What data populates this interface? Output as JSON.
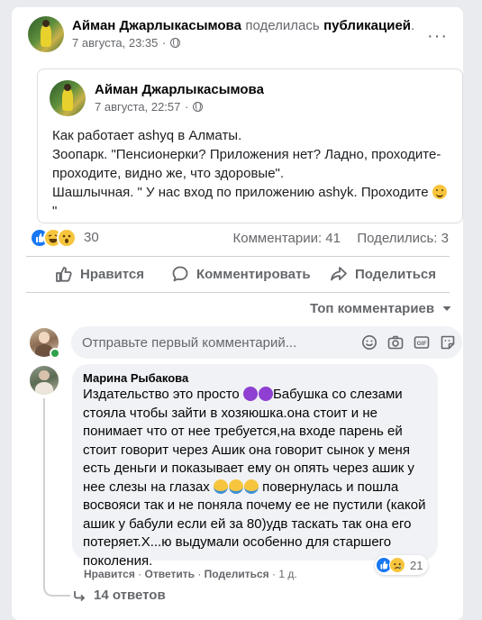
{
  "post": {
    "author": "Айман Джарлыкасымова",
    "action_pre": "поделилась",
    "action_link": "публикацией",
    "action_end": ".",
    "time": "7 августа, 23:35",
    "more": "···"
  },
  "shared": {
    "author": "Айман Джарлыкасымова",
    "time": "7 августа, 22:57",
    "text": "Как работает ashyq в Алматы.\nЗоопарк. \"Пенсионерки? Приложения нет? Ладно, проходите-\nпроходите, видно же, что здоровые\".\nШашлычная. \" У нас вход по приложению ashyk. Проходите ",
    "text_end": "\n\""
  },
  "stats": {
    "reactions_count": "30",
    "comments": "Комментарии: 41",
    "shares": "Поделились: 3"
  },
  "actions": {
    "like": "Нравится",
    "comment": "Комментировать",
    "share": "Поделиться"
  },
  "sort": {
    "label": "Топ комментариев"
  },
  "comment_input": {
    "placeholder": "Отправьте первый комментарий..."
  },
  "comment": {
    "author": "Марина Рыбакова",
    "text_1": "Издательство это просто ",
    "text_2": "Бабушка со слезами\nстояла чтобы зайти в хозяюшка.она стоит и не\nпонимает что от нее требуется,на входе парень ей\nстоит говорит через Ашик она говорит сынок у меня\nесть деньги и показывает ему он опять через ашик у\nнее слезы на глазах ",
    "text_3": " повернулась и пошла\nвосвояси так и не поняла почему ее не пустили (какой\nашик у бабули если ей за 80)удв таскать так она его\nпотеряет.Х...ю выдумали особенно для старшего\nпоколения.",
    "like": "Нравится",
    "reply": "Ответить",
    "share": "Поделиться",
    "sep": "·",
    "time": "1 д.",
    "reactions_count": "21"
  },
  "replies": {
    "label": "14 ответов"
  },
  "colors": {
    "like_blue": "#1877f2",
    "haha_yellow": "#f7c53d",
    "online_green": "#31a24c",
    "devil_purple": "#8f3fd1"
  }
}
